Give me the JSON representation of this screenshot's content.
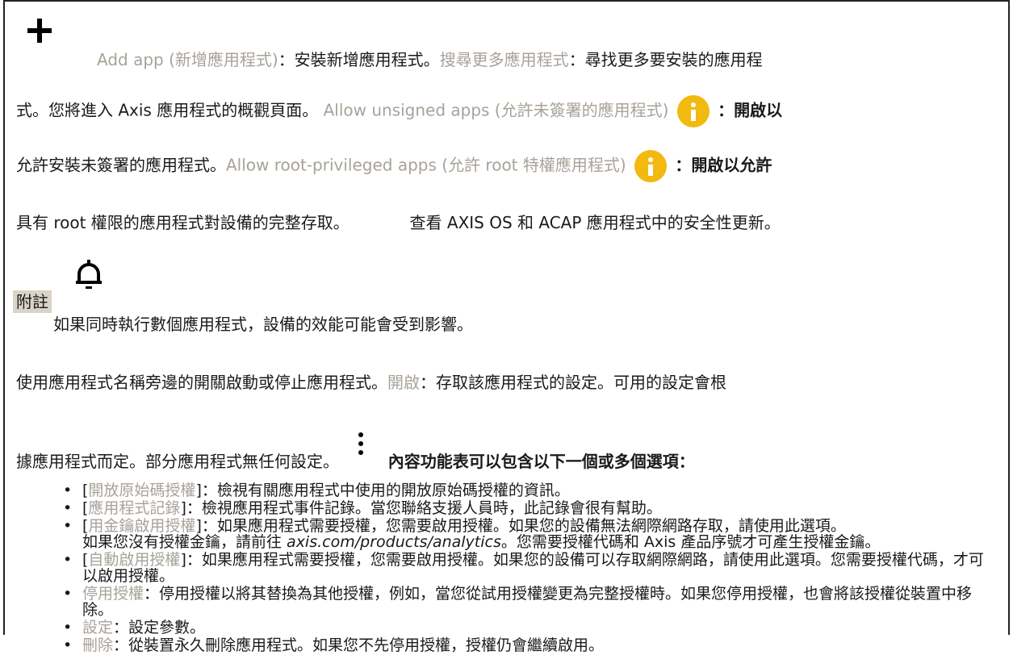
{
  "intro": {
    "add_app_link": "Add app (新增應用程式)",
    "add_app_desc": "：安裝新增應用程式。",
    "find_more_link": "搜尋更多應用程式",
    "find_more_desc_1": "：尋找更多要安裝的應用程",
    "find_more_desc_2": "式。您將進入 Axis 應用程式的概觀頁面。",
    "unsigned_link": "Allow unsigned apps (允許未簽署的應用程式)",
    "unsigned_desc_1": "：開啟以",
    "unsigned_desc_2": "允許安裝未簽署的應用程式。",
    "root_link": "Allow root-privileged apps (允許 root 特權應用程式)",
    "root_desc_1": "：開啟以允許",
    "root_desc_2": "具有 root 權限的應用程式對設備的完整存取。",
    "security_desc": "查看 AXIS OS 和 ACAP 應用程式中的安全性更新。"
  },
  "note": {
    "tag": "附註",
    "text": "如果同時執行數個應用程式，設備的效能可能會受到影響。"
  },
  "body": {
    "line1_a": "使用應用程式名稱旁邊的開關啟動或停止應用程式。",
    "open_link": "開啟",
    "line1_b": "：存取該應用程式的設定。可用的設定會根",
    "line2_a": "據應用程式而定。部分應用程式無任何設定。",
    "line2_b": "內容功能表可以包含以下一個或多個選項："
  },
  "options": [
    {
      "bracket_open": "[",
      "label": "開放原始碼授權",
      "bracket_close": "]",
      "desc": "：檢視有關應用程式中使用的開放原始碼授權的資訊。"
    },
    {
      "bracket_open": "[",
      "label": "應用程式記錄",
      "bracket_close": "]",
      "desc": "：檢視應用程式事件記錄。當您聯絡支援人員時，此記錄會很有幫助。"
    },
    {
      "bracket_open": "[",
      "label": "用金鑰啟用授權",
      "bracket_close": "]",
      "desc": "：如果應用程式需要授權，您需要啟用授權。如果您的設備無法網際網路存取，請使用此選項。",
      "extra_a": "如果您沒有授權金鑰，請前往 ",
      "extra_link": "axis.com/products/analytics",
      "extra_b": "。您需要授權代碼和 Axis 產品序號才可產生授權金鑰。"
    },
    {
      "bracket_open": "[",
      "label": "自動啟用授權",
      "bracket_close": "]",
      "desc": "：如果應用程式需要授權，您需要啟用授權。如果您的設備可以存取網際網路，請使用此選項。您需要授權代碼，才可以啟用授權。"
    },
    {
      "bracket_open": "",
      "label": "停用授權",
      "bracket_close": "",
      "desc": "：停用授權以將其替換為其他授權，例如，當您從試用授權變更為完整授權時。如果您停用授權，也會將該授權從裝置中移除。"
    },
    {
      "bracket_open": "",
      "label": "設定",
      "bracket_close": "",
      "desc": "：設定參數。"
    },
    {
      "bracket_open": "",
      "label": "刪除",
      "bracket_close": "",
      "desc": "：從裝置永久刪除應用程式。如果您不先停用授權，授權仍會繼續啟用。"
    }
  ],
  "icons": {
    "add": "plus-icon",
    "info": "info-icon",
    "bell": "bell-icon",
    "menu": "kebab-menu-icon"
  },
  "colors": {
    "link": "#a8a29a",
    "info": "#f2b90f",
    "note_bg": "#d9d3c8"
  }
}
